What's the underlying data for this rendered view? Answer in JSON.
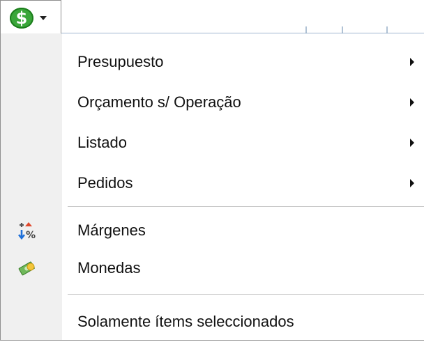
{
  "toolbar": {
    "currency_symbol": "$"
  },
  "menu": {
    "items": [
      {
        "label": "Presupuesto",
        "has_submenu": true
      },
      {
        "label": "Orçamento s/ Operação",
        "has_submenu": true
      },
      {
        "label": "Listado",
        "has_submenu": true
      },
      {
        "label": "Pedidos",
        "has_submenu": true
      },
      {
        "label": "Márgenes",
        "icon": "margin-percent-icon"
      },
      {
        "label": "Monedas",
        "icon": "money-stack-icon"
      },
      {
        "label": "Solamente ítems seleccionados"
      }
    ]
  },
  "colors": {
    "dollar_green": "#3aa63a",
    "gutter": "#f0f0f0",
    "separator": "#c8c8c8"
  }
}
